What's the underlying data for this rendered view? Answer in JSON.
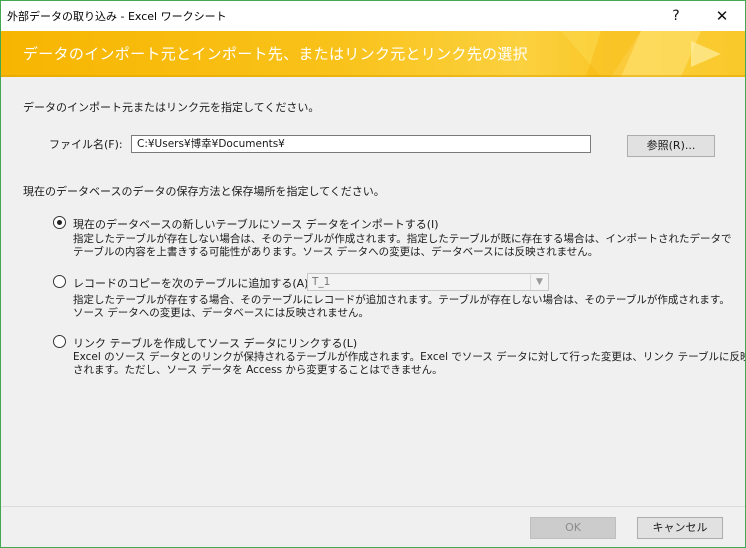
{
  "window": {
    "title": "外部データの取り込み - Excel ワークシート",
    "help_glyph": "?",
    "close_glyph": "✕",
    "border_color": "#41a854"
  },
  "banner": {
    "title": "データのインポート元とインポート先、またはリンク元とリンク先の選択",
    "color": "#f9c21a"
  },
  "source": {
    "instruction": "データのインポート元またはリンク元を指定してください。",
    "file_label": "ファイル名(F):",
    "file_value": "C:¥Users¥博幸¥Documents¥",
    "browse_label": "参照(R)..."
  },
  "storage": {
    "instruction": "現在のデータベースのデータの保存方法と保存場所を指定してください。",
    "selected": "import",
    "options": [
      {
        "id": "import",
        "label": "現在のデータベースの新しいテーブルにソース データをインポートする(I)",
        "description": [
          "指定したテーブルが存在しない場合は、そのテーブルが作成されます。指定したテーブルが既に存在する場合は、インポートされたデータで",
          "テーブルの内容を上書きする可能性があります。ソース データへの変更は、データベースには反映されません。"
        ]
      },
      {
        "id": "append",
        "label": "レコードのコピーを次のテーブルに追加する(A):",
        "combo_value": "T_1",
        "description": [
          "指定したテーブルが存在する場合、そのテーブルにレコードが追加されます。テーブルが存在しない場合は、そのテーブルが作成されます。",
          "ソース データへの変更は、データベースには反映されません。"
        ]
      },
      {
        "id": "link",
        "label": "リンク テーブルを作成してソース データにリンクする(L)",
        "description": [
          "Excel のソース データとのリンクが保持されるテーブルが作成されます。Excel でソース データに対して行った変更は、リンク テーブルに反映",
          "されます。ただし、ソース データを Access から変更することはできません。"
        ]
      }
    ]
  },
  "footer": {
    "ok_label": "OK",
    "ok_enabled": false,
    "cancel_label": "キャンセル"
  }
}
